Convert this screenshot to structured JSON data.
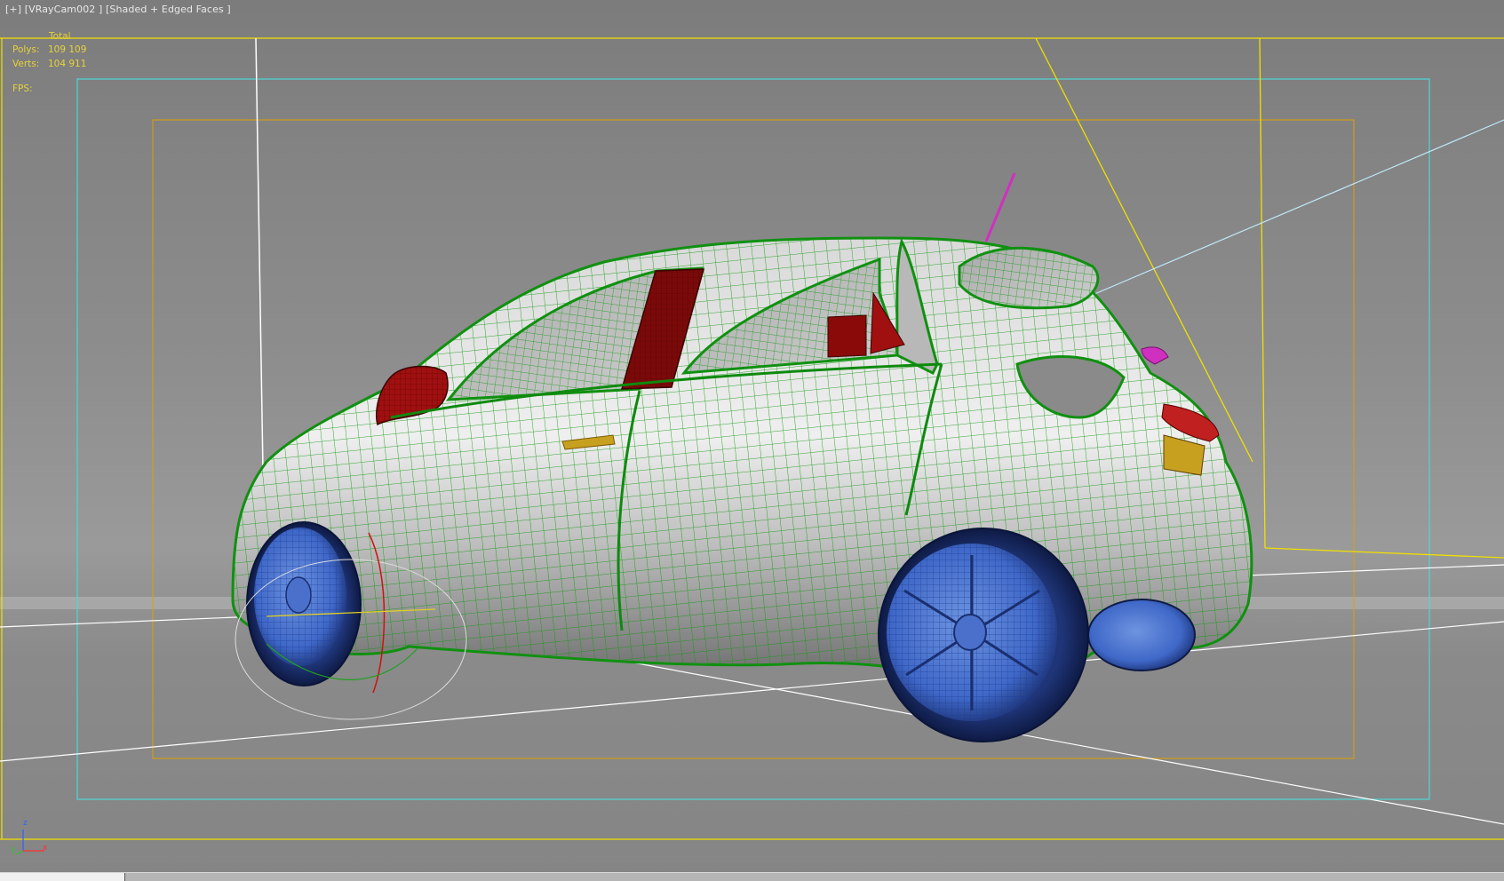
{
  "viewport": {
    "label": "[+] [VRayCam002 ] [Shaded + Edged Faces ]",
    "background": "#8a8a8a",
    "stats": {
      "header": "Total",
      "polys_label": "Polys:",
      "polys_value": "109 109",
      "verts_label": "Verts:",
      "verts_value": "104 911",
      "fps_label": "FPS:"
    },
    "colors": {
      "stats_text": "#e6d23a",
      "safe_frame_outer": "#4fd6d6",
      "safe_frame_inner": "#e0a000",
      "body_wire": "#18a018",
      "wheel_wire": "#2a50b8",
      "highlight_red": "#a01010",
      "highlight_magenta": "#d030c0",
      "highlight_gold": "#c8a020",
      "viewport_border": "#f0e000"
    }
  },
  "axis": {
    "z": "z",
    "y": "y",
    "x": "x"
  },
  "icons": [
    "axis-tripod-icon",
    "camera-target-line-icon"
  ]
}
